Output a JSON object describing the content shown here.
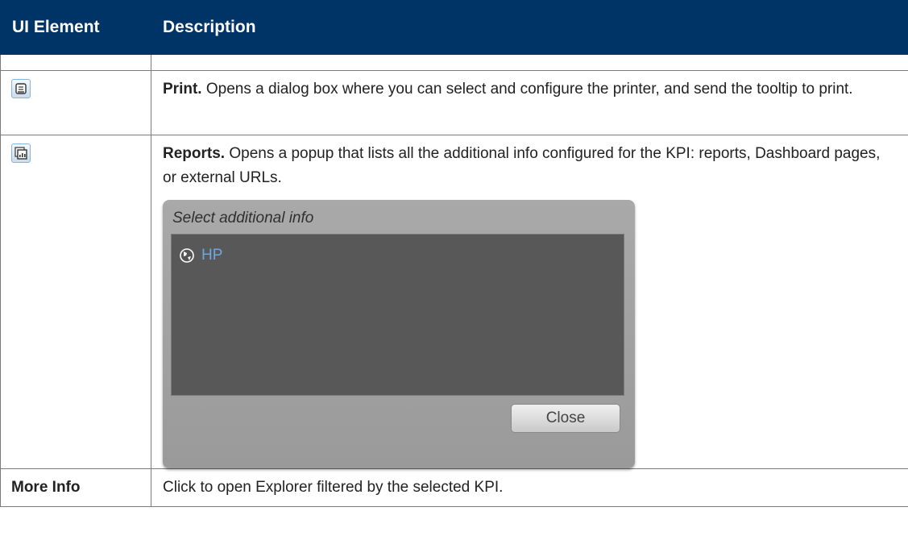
{
  "header": {
    "col1": "UI Element",
    "col2": "Description"
  },
  "rows": {
    "print": {
      "icon": "print-icon",
      "title": "Print.",
      "text": "Opens a dialog box where you can select and configure the printer, and send the tooltip to print."
    },
    "reports": {
      "icon": "reports-icon",
      "title": "Reports.",
      "text": "Opens a popup that lists all the additional info configured for the KPI: reports, Dashboard pages, or external URLs.",
      "popup": {
        "title": "Select additional info",
        "items": [
          {
            "icon": "globe-icon",
            "label": "HP"
          }
        ],
        "close_label": "Close"
      }
    },
    "more": {
      "label": "More Info",
      "text": "Click to open Explorer filtered by the selected KPI."
    }
  },
  "colors": {
    "header_bg": "#003366",
    "link": "#6fa6e0"
  }
}
